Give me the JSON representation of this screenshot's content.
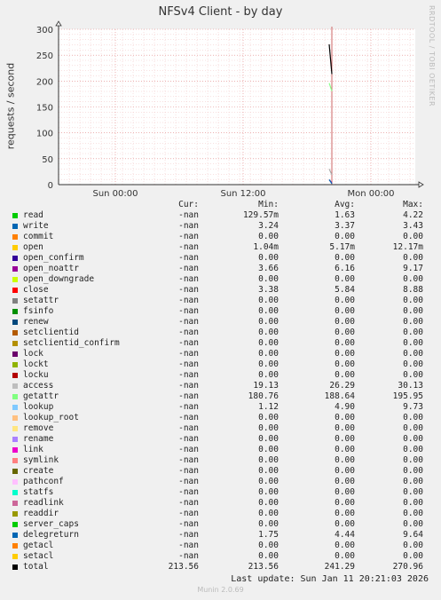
{
  "title": "NFSv4 Client - by day",
  "side_label": "RRDTOOL / TOBI OETIKER",
  "chart_data": {
    "type": "line",
    "title": "NFSv4 Client - by day",
    "ylabel": "requests / second",
    "ylim": [
      0,
      300
    ],
    "yticks": [
      "0",
      "50",
      "100",
      "150",
      "200",
      "250",
      "300"
    ],
    "xticks": [
      "Sun 00:00",
      "Sun 12:00",
      "Mon 00:00"
    ],
    "series": [
      {
        "name": "total",
        "color": "#000000",
        "values": [
          270.96,
          213.56
        ]
      },
      {
        "name": "getattr",
        "color": "#88ff88",
        "values": [
          195.95,
          180.76
        ]
      },
      {
        "name": "access",
        "color": "#aaaaaa",
        "values": [
          30.13,
          19.13
        ]
      },
      {
        "name": "open_noattr",
        "color": "#9900aa",
        "values": [
          9.17,
          3.66
        ]
      },
      {
        "name": "delegreturn",
        "color": "#0066b3",
        "values": [
          9.64,
          1.75
        ]
      }
    ]
  },
  "legend_headers": {
    "cur": "Cur:",
    "min": "Min:",
    "avg": "Avg:",
    "max": "Max:"
  },
  "legend": [
    {
      "name": "read",
      "color": "#00cc00",
      "cur": "-nan",
      "min": "129.57m",
      "avg": "1.63",
      "max": "4.22"
    },
    {
      "name": "write",
      "color": "#0066b3",
      "cur": "-nan",
      "min": "3.24",
      "avg": "3.37",
      "max": "3.43"
    },
    {
      "name": "commit",
      "color": "#ff8000",
      "cur": "-nan",
      "min": "0.00",
      "avg": "0.00",
      "max": "0.00"
    },
    {
      "name": "open",
      "color": "#ffcc00",
      "cur": "-nan",
      "min": "1.04m",
      "avg": "5.17m",
      "max": "12.17m"
    },
    {
      "name": "open_confirm",
      "color": "#330099",
      "cur": "-nan",
      "min": "0.00",
      "avg": "0.00",
      "max": "0.00"
    },
    {
      "name": "open_noattr",
      "color": "#990099",
      "cur": "-nan",
      "min": "3.66",
      "avg": "6.16",
      "max": "9.17"
    },
    {
      "name": "open_downgrade",
      "color": "#ccff00",
      "cur": "-nan",
      "min": "0.00",
      "avg": "0.00",
      "max": "0.00"
    },
    {
      "name": "close",
      "color": "#ff0000",
      "cur": "-nan",
      "min": "3.38",
      "avg": "5.84",
      "max": "8.88"
    },
    {
      "name": "setattr",
      "color": "#808080",
      "cur": "-nan",
      "min": "0.00",
      "avg": "0.00",
      "max": "0.00"
    },
    {
      "name": "fsinfo",
      "color": "#008f00",
      "cur": "-nan",
      "min": "0.00",
      "avg": "0.00",
      "max": "0.00"
    },
    {
      "name": "renew",
      "color": "#00487d",
      "cur": "-nan",
      "min": "0.00",
      "avg": "0.00",
      "max": "0.00"
    },
    {
      "name": "setclientid",
      "color": "#b35a00",
      "cur": "-nan",
      "min": "0.00",
      "avg": "0.00",
      "max": "0.00"
    },
    {
      "name": "setclientid_confirm",
      "color": "#b38f00",
      "cur": "-nan",
      "min": "0.00",
      "avg": "0.00",
      "max": "0.00"
    },
    {
      "name": "lock",
      "color": "#6b006b",
      "cur": "-nan",
      "min": "0.00",
      "avg": "0.00",
      "max": "0.00"
    },
    {
      "name": "lockt",
      "color": "#8fb300",
      "cur": "-nan",
      "min": "0.00",
      "avg": "0.00",
      "max": "0.00"
    },
    {
      "name": "locku",
      "color": "#b30000",
      "cur": "-nan",
      "min": "0.00",
      "avg": "0.00",
      "max": "0.00"
    },
    {
      "name": "access",
      "color": "#bebebe",
      "cur": "-nan",
      "min": "19.13",
      "avg": "26.29",
      "max": "30.13"
    },
    {
      "name": "getattr",
      "color": "#80ff80",
      "cur": "-nan",
      "min": "180.76",
      "avg": "188.64",
      "max": "195.95"
    },
    {
      "name": "lookup",
      "color": "#80c9ff",
      "cur": "-nan",
      "min": "1.12",
      "avg": "4.90",
      "max": "9.73"
    },
    {
      "name": "lookup_root",
      "color": "#ffc080",
      "cur": "-nan",
      "min": "0.00",
      "avg": "0.00",
      "max": "0.00"
    },
    {
      "name": "remove",
      "color": "#ffe680",
      "cur": "-nan",
      "min": "0.00",
      "avg": "0.00",
      "max": "0.00"
    },
    {
      "name": "rename",
      "color": "#aa80ff",
      "cur": "-nan",
      "min": "0.00",
      "avg": "0.00",
      "max": "0.00"
    },
    {
      "name": "link",
      "color": "#ee00cc",
      "cur": "-nan",
      "min": "0.00",
      "avg": "0.00",
      "max": "0.00"
    },
    {
      "name": "symlink",
      "color": "#ff8080",
      "cur": "-nan",
      "min": "0.00",
      "avg": "0.00",
      "max": "0.00"
    },
    {
      "name": "create",
      "color": "#666600",
      "cur": "-nan",
      "min": "0.00",
      "avg": "0.00",
      "max": "0.00"
    },
    {
      "name": "pathconf",
      "color": "#ffbfff",
      "cur": "-nan",
      "min": "0.00",
      "avg": "0.00",
      "max": "0.00"
    },
    {
      "name": "statfs",
      "color": "#00ffcc",
      "cur": "-nan",
      "min": "0.00",
      "avg": "0.00",
      "max": "0.00"
    },
    {
      "name": "readlink",
      "color": "#cc6699",
      "cur": "-nan",
      "min": "0.00",
      "avg": "0.00",
      "max": "0.00"
    },
    {
      "name": "readdir",
      "color": "#999900",
      "cur": "-nan",
      "min": "0.00",
      "avg": "0.00",
      "max": "0.00"
    },
    {
      "name": "server_caps",
      "color": "#00cc00",
      "cur": "-nan",
      "min": "0.00",
      "avg": "0.00",
      "max": "0.00"
    },
    {
      "name": "delegreturn",
      "color": "#0066b3",
      "cur": "-nan",
      "min": "1.75",
      "avg": "4.44",
      "max": "9.64"
    },
    {
      "name": "getacl",
      "color": "#ff8000",
      "cur": "-nan",
      "min": "0.00",
      "avg": "0.00",
      "max": "0.00"
    },
    {
      "name": "setacl",
      "color": "#ffcc00",
      "cur": "-nan",
      "min": "0.00",
      "avg": "0.00",
      "max": "0.00"
    },
    {
      "name": "total",
      "color": "#000000",
      "cur": "213.56",
      "min": "213.56",
      "avg": "241.29",
      "max": "270.96"
    }
  ],
  "last_update": "Last update: Sun Jan 11 20:21:03 2026",
  "footer": "Munin 2.0.69"
}
